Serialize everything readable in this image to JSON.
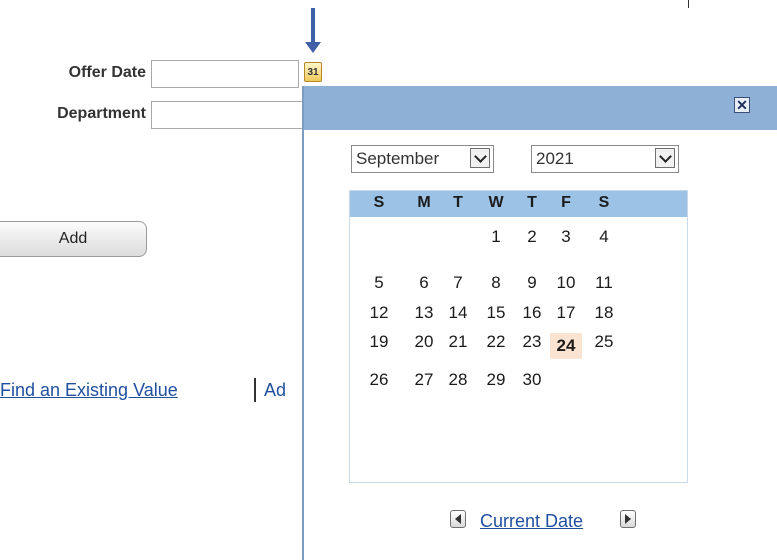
{
  "form": {
    "offer_date_label": "Offer Date",
    "offer_date_value": "",
    "department_label": "Department",
    "department_value": "",
    "calendar_button_text": "31",
    "add_button_label": "Add",
    "find_existing_link": "Find an Existing Value",
    "add_link_partial": "Ad"
  },
  "calendar": {
    "close_glyph": "✕",
    "month": "September",
    "year": "2021",
    "weekdays": [
      "S",
      "M",
      "T",
      "W",
      "T",
      "F",
      "S"
    ],
    "weeks": [
      [
        "",
        "",
        "",
        "1",
        "2",
        "3",
        "4"
      ],
      [
        "5",
        "6",
        "7",
        "8",
        "9",
        "10",
        "11"
      ],
      [
        "12",
        "13",
        "14",
        "15",
        "16",
        "17",
        "18"
      ],
      [
        "19",
        "20",
        "21",
        "22",
        "23",
        "24",
        "25"
      ],
      [
        "26",
        "27",
        "28",
        "29",
        "30",
        "",
        ""
      ]
    ],
    "today": "24",
    "current_date_link": "Current Date",
    "colors": {
      "header": "#8fb0d6",
      "weekday_bar": "#9cc2e5",
      "today_highlight": "#fbe3d2",
      "link": "#1f4f9f"
    }
  }
}
